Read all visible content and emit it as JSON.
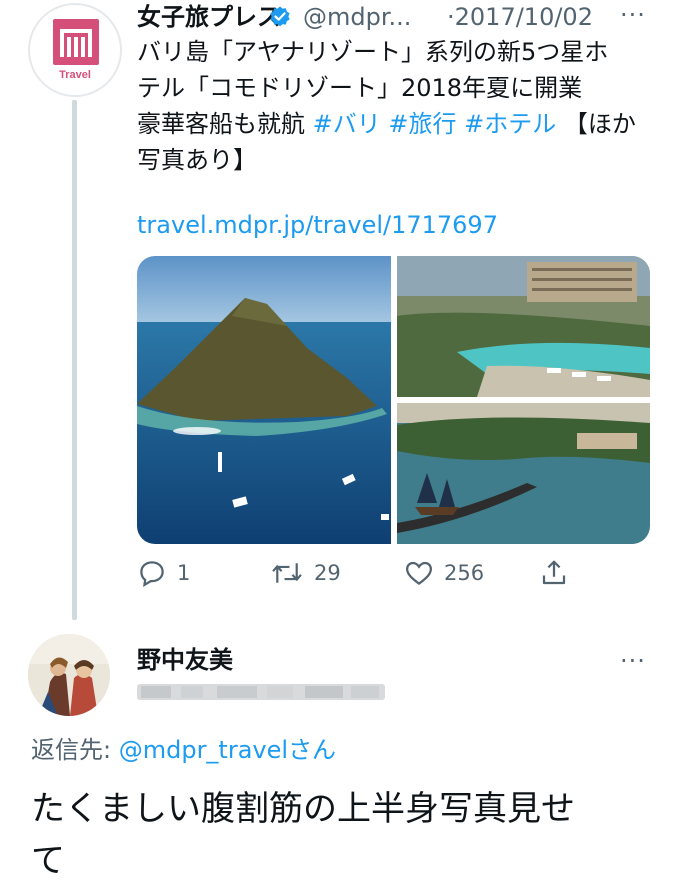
{
  "tweet": {
    "avatar_label": "Travel",
    "author_name": "女子旅プレス",
    "handle": "@mdpr...",
    "date": "·2017/10/02",
    "more": "···",
    "text_lines": [
      "バリ島「アヤナリゾート」系列の新5つ星ホ",
      "テル「コモドリゾート」2018年夏に開業"
    ],
    "line3_prefix": "豪華客船も就航 ",
    "hashtags": [
      "#バリ",
      "#旅行",
      "#ホテル"
    ],
    "line3_suffix": "【ほか",
    "line4": "写真あり】",
    "link": "travel.mdpr.jp/travel/1717697",
    "replies": "1",
    "retweets": "29",
    "likes": "256"
  },
  "reply": {
    "author_name": "野中友美",
    "more": "···",
    "reply_to_prefix": "返信先: ",
    "reply_to_mention": "@mdpr_travel",
    "reply_to_suffix": "さん",
    "text_lines": [
      "たくましい腹割筋の上半身写真見せ",
      "て"
    ]
  },
  "colors": {
    "link": "#1d9bf0",
    "secondary_text": "#536471",
    "brand_pink": "#d4507a"
  },
  "icons": [
    "verified-badge-icon",
    "reply-icon",
    "retweet-icon",
    "like-icon",
    "share-icon",
    "more-icon"
  ]
}
